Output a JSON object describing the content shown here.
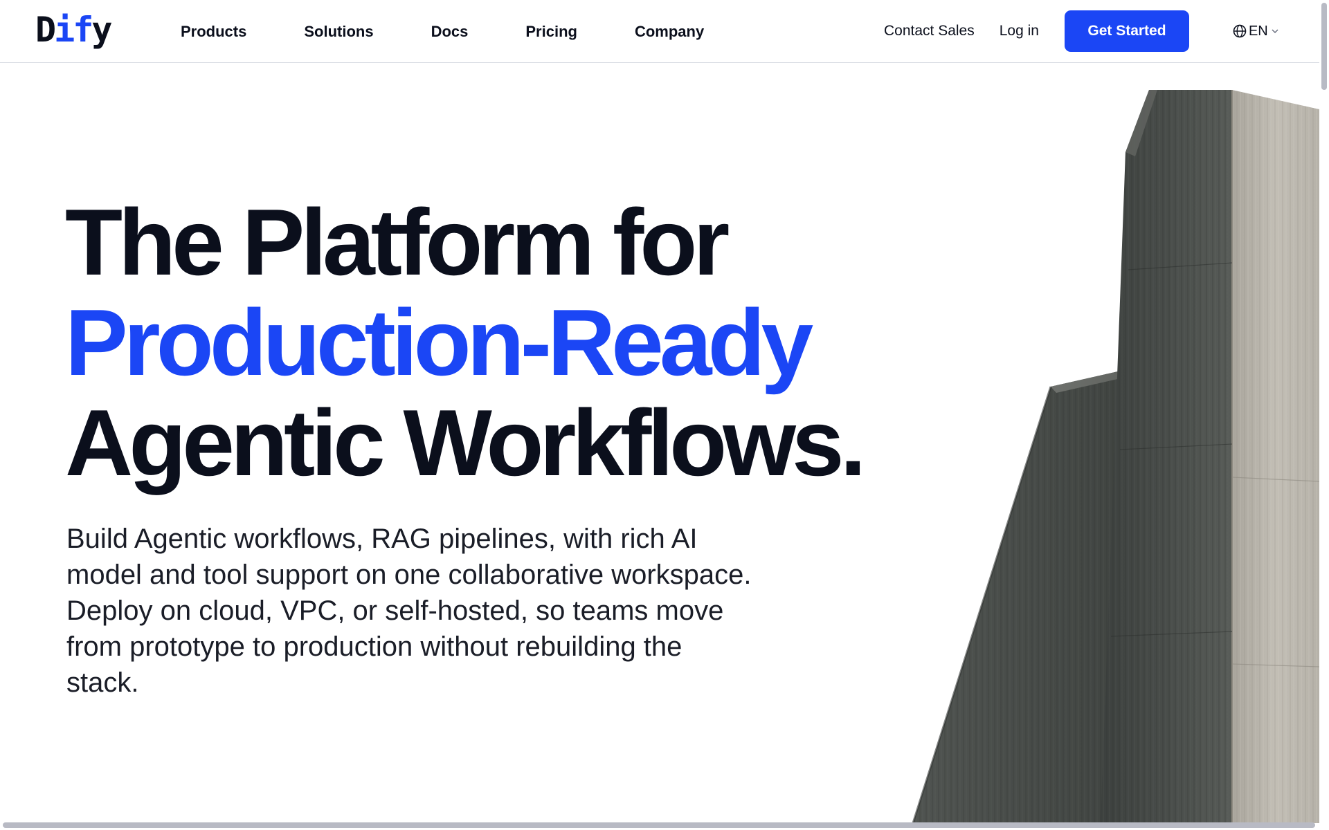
{
  "header": {
    "logo_prefix": "D",
    "logo_accent": "if",
    "logo_suffix": "y",
    "nav": [
      "Products",
      "Solutions",
      "Docs",
      "Pricing",
      "Company"
    ],
    "contact_sales": "Contact Sales",
    "login": "Log in",
    "get_started": "Get Started",
    "language": "EN"
  },
  "hero": {
    "title_line1": "The Platform for",
    "title_line2": "Production-Ready",
    "title_line3": "Agentic Workflows.",
    "subtitle": "Build Agentic workflows, RAG pipelines, with rich AI model and tool support on one collaborative workspace. Deploy on cloud, VPC, or self-hosted, so teams move from prototype to production without rebuilding the stack."
  },
  "colors": {
    "brand": "#1b46f5",
    "text": "#0b0f1c",
    "background": "#ffffff"
  },
  "icons": {
    "language": "globe-icon",
    "language_dropdown": "chevron-down-icon",
    "hero_image": "concrete-pillars-illustration"
  }
}
